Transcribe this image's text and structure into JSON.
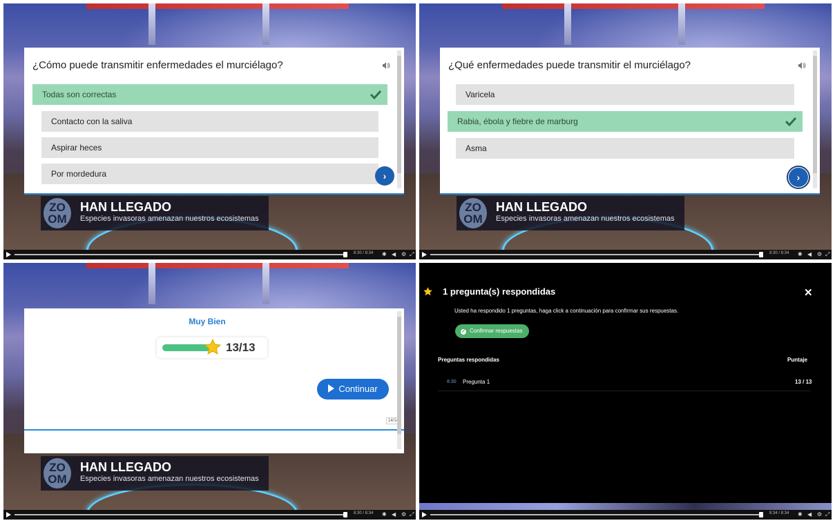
{
  "quiz1": {
    "question": "¿Cómo puede transmitir enfermedades el murciélago?",
    "options": [
      "Todas son correctas",
      "Contacto con la saliva",
      "Aspirar heces",
      "Por mordedura"
    ],
    "correct_index": 0
  },
  "quiz2": {
    "question": "¿Qué enfermedades puede transmitir el murciélago?",
    "options": [
      "Varicela",
      "Rabia, ébola y fiebre de marburg",
      "Asma"
    ],
    "correct_index": 1
  },
  "lower_third": {
    "logo_top": "ZO",
    "logo_bottom": "OM",
    "title": "HAN LLEGADO",
    "subtitle": "Especies invasoras amenazan nuestros ecosistemas"
  },
  "result": {
    "heading": "Muy Bien",
    "score": "13/13",
    "progress": 1.0,
    "continue_label": "Continuar",
    "page_counter": "14/14"
  },
  "summary": {
    "title": "1 pregunta(s) respondidas",
    "description": "Usted ha respondido 1 preguntas, haga click a continuación para confirmar sus respuestas.",
    "confirm_label": "Confirmar respuestas",
    "col_left": "Preguntas respondidas",
    "col_right": "Puntaje",
    "rows": [
      {
        "time": "8:30",
        "name": "Pregunta 1",
        "score": "13 / 13"
      }
    ]
  },
  "player": {
    "time_a": "8:30 / 8:34",
    "time_b": "8:34 / 8:34"
  },
  "colors": {
    "correct_bg": "#98d8b4",
    "accent_blue": "#1d6fd1",
    "success_green": "#4caf6a"
  }
}
